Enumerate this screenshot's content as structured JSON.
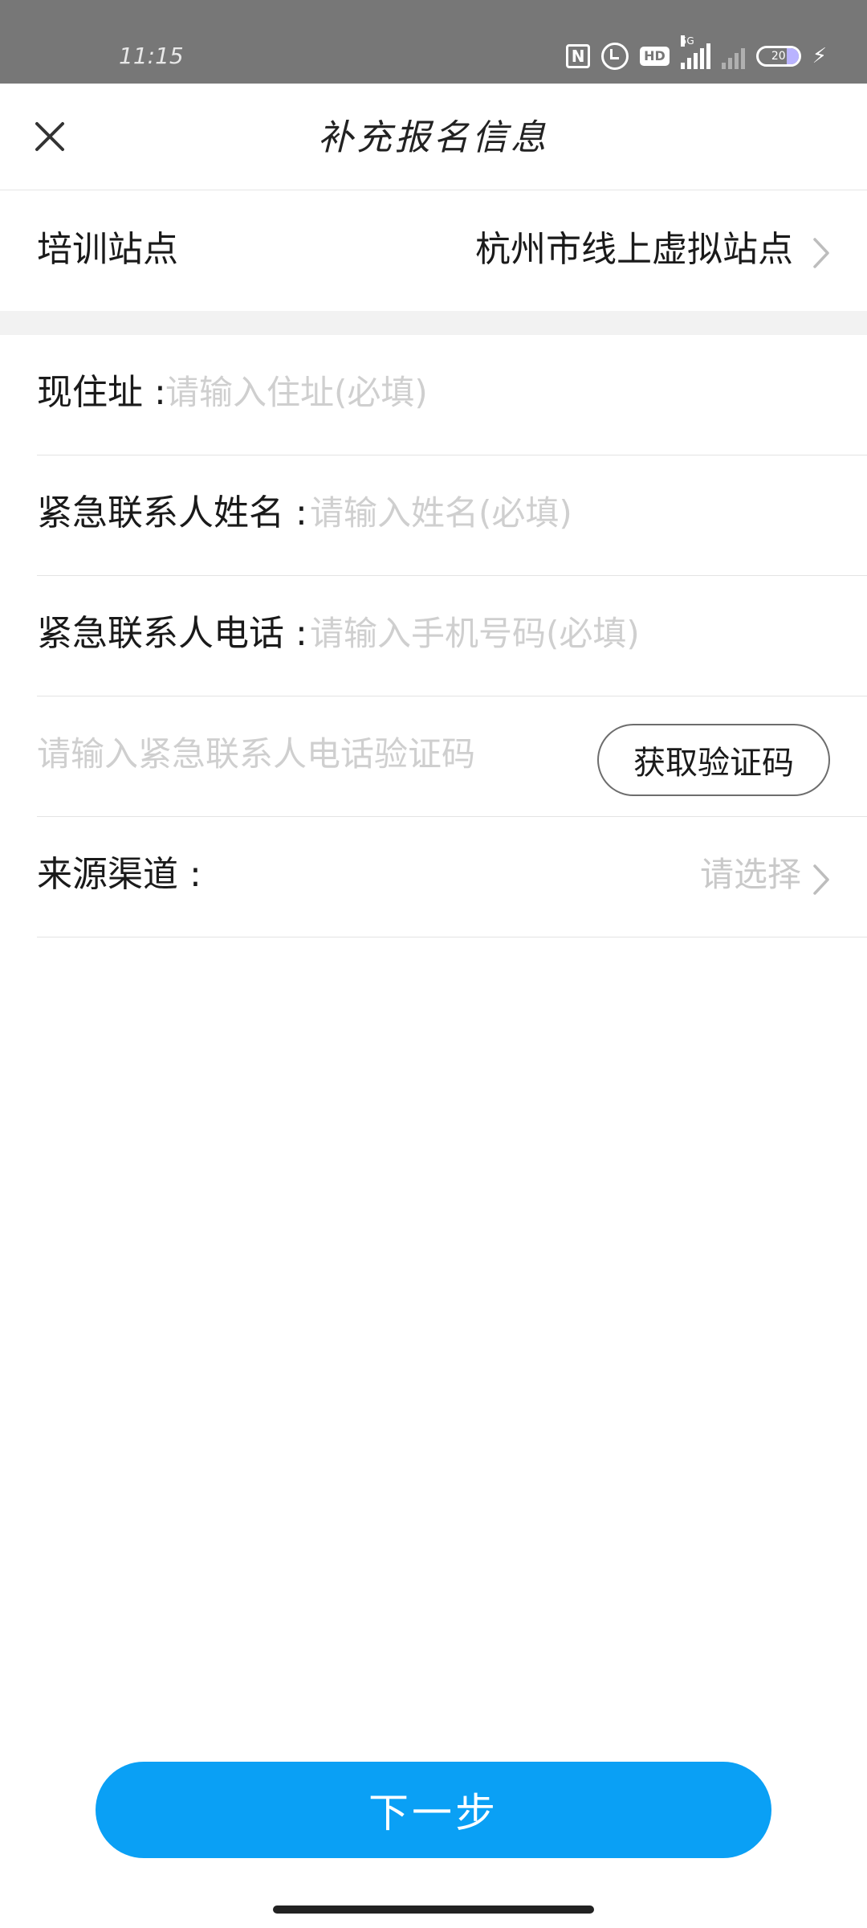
{
  "status_bar": {
    "time": "11:15",
    "nfc_label": "N",
    "hd_label": "HD",
    "network_label": "5G",
    "battery_level": "20"
  },
  "header": {
    "title": "补充报名信息"
  },
  "station": {
    "label": "培训站点",
    "value": "杭州市线上虚拟站点"
  },
  "form": {
    "address_label": "现住址 :",
    "address_placeholder": "请输入住址(必填)",
    "contact_name_label": "紧急联系人姓名 :",
    "contact_name_placeholder": "请输入姓名(必填)",
    "contact_phone_label": "紧急联系人电话 :",
    "contact_phone_placeholder": "请输入手机号码(必填)",
    "verify_code_placeholder": "请输入紧急联系人电话验证码",
    "get_code_button": "获取验证码",
    "source_label": "来源渠道 :",
    "source_select_placeholder": "请选择"
  },
  "footer": {
    "next_button": "下一步"
  },
  "colors": {
    "primary": "#0aa0f5",
    "placeholder": "#cfcfcf",
    "status_bar": "#777777",
    "divider": "#e3e3e3"
  }
}
